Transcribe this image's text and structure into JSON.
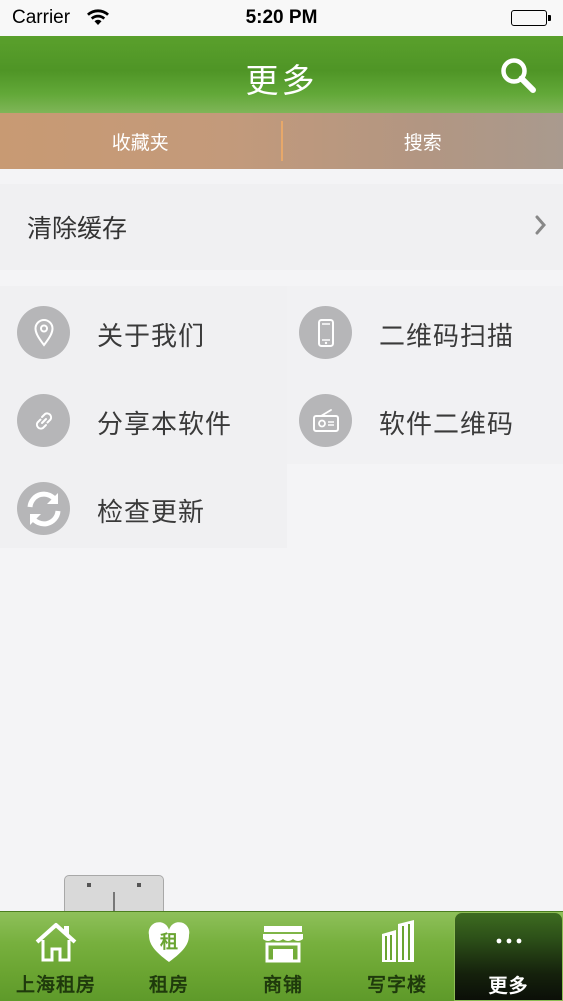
{
  "status_bar": {
    "carrier": "Carrier",
    "time": "5:20 PM"
  },
  "nav": {
    "title": "更多",
    "search_icon": "search-icon"
  },
  "segments": [
    {
      "label": "收藏夹"
    },
    {
      "label": "搜索"
    }
  ],
  "clear_cache": {
    "label": "清除缓存",
    "chevron": "chevron-right-icon"
  },
  "grid": [
    {
      "label": "关于我们",
      "icon": "location-pin-icon"
    },
    {
      "label": "二维码扫描",
      "icon": "phone-icon"
    },
    {
      "label": "分享本软件",
      "icon": "link-icon"
    },
    {
      "label": "软件二维码",
      "icon": "radio-icon"
    },
    {
      "label": "检查更新",
      "icon": "refresh-icon"
    }
  ],
  "tabs": [
    {
      "label": "上海租房",
      "icon": "house-icon"
    },
    {
      "label": "租房",
      "icon": "rent-heart-icon",
      "badge": "租"
    },
    {
      "label": "商铺",
      "icon": "shop-icon"
    },
    {
      "label": "写字楼",
      "icon": "building-icon"
    },
    {
      "label": "更多",
      "icon": "more-dots-icon",
      "active": true
    }
  ],
  "colors": {
    "nav_green": "#4f9526",
    "segment_tan": "#c39a7b",
    "icon_gray": "#b6b6b8"
  }
}
